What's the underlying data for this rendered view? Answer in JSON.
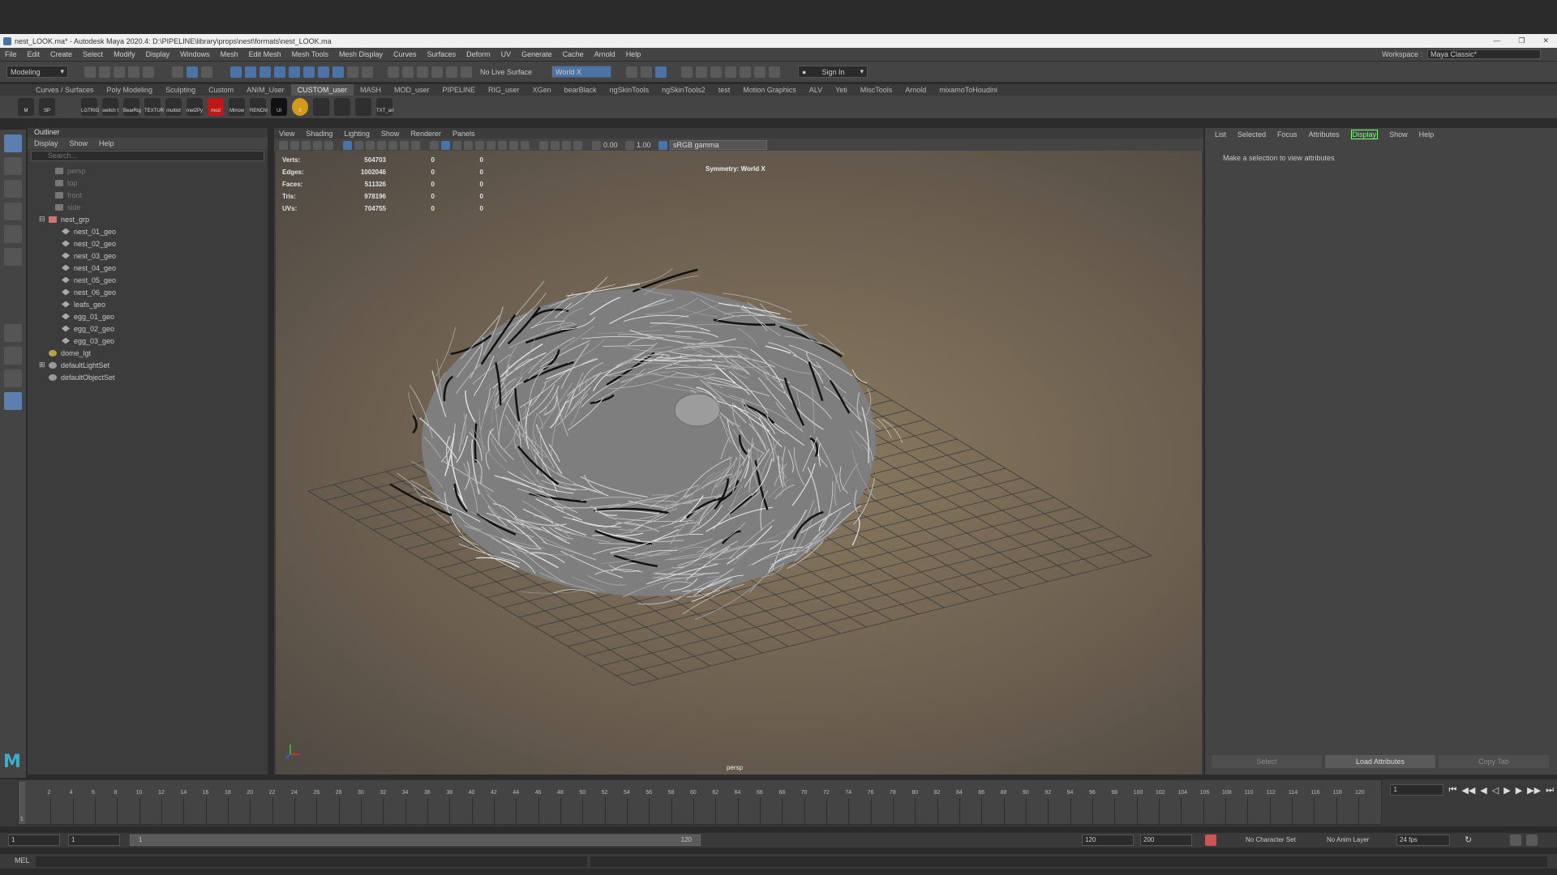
{
  "window": {
    "title": "nest_LOOK.ma* - Autodesk Maya 2020.4: D:\\PIPELINE\\library\\props\\nest\\formats\\nest_LOOK.ma"
  },
  "menubar": [
    "File",
    "Edit",
    "Create",
    "Select",
    "Modify",
    "Display",
    "Windows",
    "Mesh",
    "Edit Mesh",
    "Mesh Tools",
    "Mesh Display",
    "Curves",
    "Surfaces",
    "Deform",
    "UV",
    "Generate",
    "Cache",
    "Arnold",
    "Help"
  ],
  "workspace": {
    "label": "Workspace :",
    "value": "Maya Classic*"
  },
  "statusline": {
    "mode": "Modeling",
    "live_surface": "No Live Surface",
    "symmetry": "World X",
    "sign_in": "Sign In"
  },
  "shelf_tabs": [
    "Curves / Surfaces",
    "Poly Modeling",
    "Sculpting",
    "Custom",
    "ANIM_User",
    "CUSTOM_user",
    "MASH",
    "MOD_user",
    "PIPELINE",
    "RIG_user",
    "XGen",
    "bearBlack",
    "ngSkinTools",
    "ngSkinTools2",
    "test",
    "Motion Graphics",
    "ALV",
    "Yeti",
    "MiscTools",
    "Arnold",
    "mixamoToHoudini"
  ],
  "shelf_active_tab": "CUSTOM_user",
  "shelf_icons": [
    "M",
    "SP",
    "LGTRIG",
    "switch t",
    "BearRig",
    "TEXTUR",
    "multiot",
    "mel2Py",
    "mod",
    "Mirrow",
    "RENChi",
    "UI",
    "5",
    "",
    "",
    "",
    "TXT_arr"
  ],
  "outliner": {
    "title": "Outliner",
    "menu": [
      "Display",
      "Show",
      "Help"
    ],
    "search_placeholder": "Search...",
    "items": [
      {
        "label": "persp",
        "type": "cam",
        "indent": 1,
        "dim": true
      },
      {
        "label": "top",
        "type": "cam",
        "indent": 1,
        "dim": true
      },
      {
        "label": "front",
        "type": "cam",
        "indent": 1,
        "dim": true
      },
      {
        "label": "side",
        "type": "cam",
        "indent": 1,
        "dim": true
      },
      {
        "label": "nest_grp",
        "type": "grp",
        "indent": 0,
        "expander": "-"
      },
      {
        "label": "nest_01_geo",
        "type": "mesh",
        "indent": 2
      },
      {
        "label": "nest_02_geo",
        "type": "mesh",
        "indent": 2
      },
      {
        "label": "nest_03_geo",
        "type": "mesh",
        "indent": 2
      },
      {
        "label": "nest_04_geo",
        "type": "mesh",
        "indent": 2
      },
      {
        "label": "nest_05_geo",
        "type": "mesh",
        "indent": 2
      },
      {
        "label": "nest_06_geo",
        "type": "mesh",
        "indent": 2
      },
      {
        "label": "leafs_geo",
        "type": "mesh",
        "indent": 2
      },
      {
        "label": "egg_01_geo",
        "type": "mesh",
        "indent": 2
      },
      {
        "label": "egg_02_geo",
        "type": "mesh",
        "indent": 2
      },
      {
        "label": "egg_03_geo",
        "type": "mesh",
        "indent": 2
      },
      {
        "label": "dome_lgt",
        "type": "lgt",
        "indent": 0
      },
      {
        "label": "defaultLightSet",
        "type": "set",
        "indent": 0,
        "expander": "+"
      },
      {
        "label": "defaultObjectSet",
        "type": "set",
        "indent": 0
      }
    ]
  },
  "viewport": {
    "menu": [
      "View",
      "Shading",
      "Lighting",
      "Show",
      "Renderer",
      "Panels"
    ],
    "exposure": "0.00",
    "gamma_value": "1.00",
    "color_space": "sRGB gamma",
    "hud": [
      {
        "label": "Verts:",
        "v1": "504703",
        "v2": "0",
        "v3": "0"
      },
      {
        "label": "Edges:",
        "v1": "1002046",
        "v2": "0",
        "v3": "0"
      },
      {
        "label": "Faces:",
        "v1": "511326",
        "v2": "0",
        "v3": "0"
      },
      {
        "label": "Tris:",
        "v1": "978196",
        "v2": "0",
        "v3": "0"
      },
      {
        "label": "UVs:",
        "v1": "704755",
        "v2": "0",
        "v3": "0"
      }
    ],
    "symmetry": "Symmetry: World X",
    "camera": "persp"
  },
  "attribute_editor": {
    "menu": [
      "List",
      "Selected",
      "Focus",
      "Attributes",
      "Display",
      "Show",
      "Help"
    ],
    "message": "Make a selection to view attributes",
    "buttons": [
      "Select",
      "Load Attributes",
      "Copy Tab"
    ]
  },
  "timeslider": {
    "ticks": [
      "2",
      "4",
      "6",
      "8",
      "10",
      "12",
      "14",
      "16",
      "18",
      "20",
      "22",
      "24",
      "26",
      "28",
      "30",
      "32",
      "34",
      "36",
      "38",
      "40",
      "42",
      "44",
      "46",
      "48",
      "50",
      "52",
      "54",
      "56",
      "58",
      "60",
      "62",
      "64",
      "66",
      "68",
      "70",
      "72",
      "74",
      "76",
      "78",
      "80",
      "82",
      "84",
      "86",
      "88",
      "90",
      "92",
      "94",
      "96",
      "98",
      "100",
      "102",
      "104",
      "106",
      "108",
      "110",
      "112",
      "114",
      "116",
      "118",
      "120"
    ],
    "current_frame": "1",
    "current_field": "1"
  },
  "range": {
    "start": "1",
    "start2": "1",
    "bar_start": "1",
    "bar_end": "120",
    "end": "120",
    "anim_end": "200",
    "character_set": "No Character Set",
    "anim_layer": "No Anim Layer",
    "fps": "24 fps"
  },
  "cmdline": {
    "label": "MEL"
  }
}
